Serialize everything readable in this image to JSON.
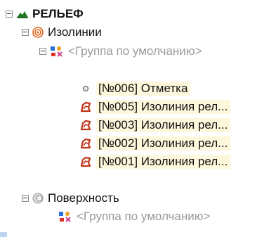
{
  "tree": {
    "root": {
      "label": "РЕЛЬЕФ",
      "icon": "mountain-icon",
      "color": "#1f7a1f"
    },
    "isolines": {
      "label": "Изолинии",
      "icon": "isolines-icon",
      "color": "#e0641a"
    },
    "isolines_group": {
      "label": "<Группа по умолчанию>",
      "icon": "default-group-icon"
    },
    "items": [
      {
        "label": "[№006] Отметка",
        "icon": "point-mark-icon"
      },
      {
        "label": "[№005] Изолиния рел...",
        "icon": "isoline-item-icon"
      },
      {
        "label": "[№003] Изолиния рел...",
        "icon": "isoline-item-icon"
      },
      {
        "label": "[№002] Изолиния рел...",
        "icon": "isoline-item-icon"
      },
      {
        "label": "[№001] Изолиния рел...",
        "icon": "isoline-item-icon"
      }
    ],
    "surface": {
      "label": "Поверхность",
      "icon": "surface-icon"
    },
    "surface_group": {
      "label": "<Группа по умолчанию>",
      "icon": "default-group-icon"
    }
  },
  "colors": {
    "highlight": "#fdf7dc",
    "muted_text": "#9a9a9a",
    "isoline_icon": "#c0341a"
  }
}
